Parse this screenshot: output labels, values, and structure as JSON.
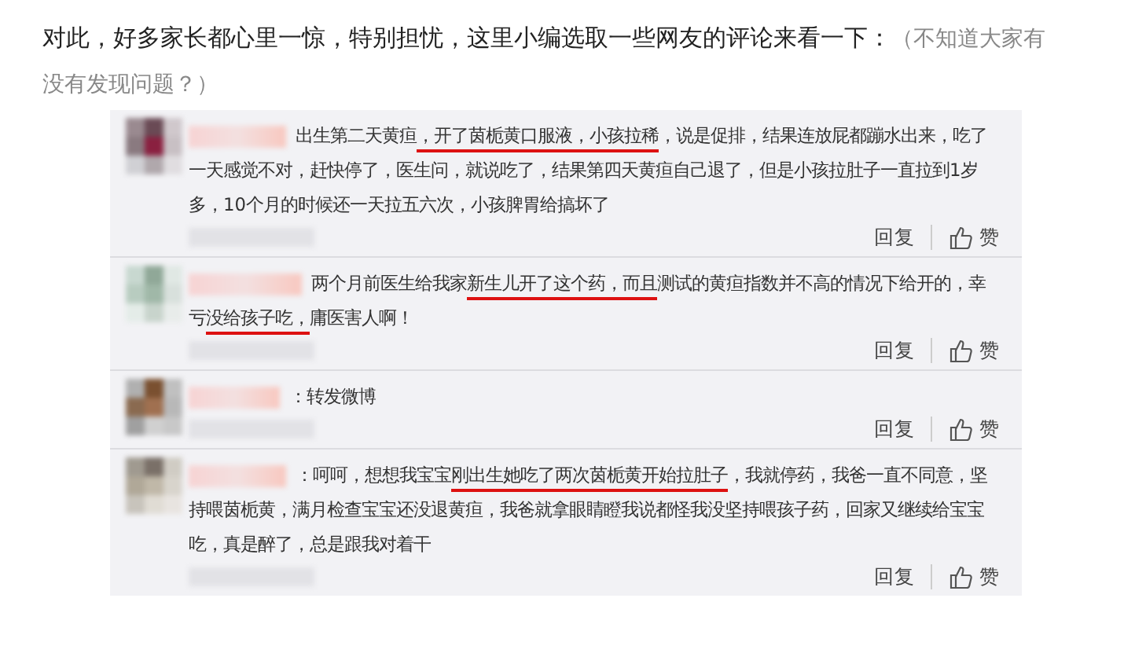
{
  "intro": {
    "text": "对此，好多家长都心里一惊，特别担忧，这里小编选取一些网友的评论来看一下：",
    "note": "（不知道大家有没有发现问题？）"
  },
  "comments": [
    {
      "segments": [
        {
          "text": "出生第二天黄疸",
          "underlined": false
        },
        {
          "text": "，开了茵栀黄口服液，小孩拉稀",
          "underlined": true
        },
        {
          "text": "，说是促排，结果连放屁都蹦水出来，吃了一天感觉不对，赶快停了，医生问，就说吃了，结果第四天黄疸自己退了，但是小孩拉肚子一直拉到1岁多，10个月的时候还一天拉五六次，小孩脾胃给搞坏了",
          "underlined": false
        }
      ],
      "reply": "回复",
      "like": "赞"
    },
    {
      "segments": [
        {
          "text": "两个月前医生给我家",
          "underlined": false
        },
        {
          "text": "新生儿开了这个药，而且",
          "underlined": true
        },
        {
          "text": "测试的黄疸指数并不高的情况下给开的，幸亏",
          "underlined": false
        },
        {
          "text": "没给孩子吃，",
          "underlined": true
        },
        {
          "text": "庸医害人啊！",
          "underlined": false
        }
      ],
      "reply": "回复",
      "like": "赞"
    },
    {
      "segments": [
        {
          "text": "：转发微博",
          "underlined": false
        }
      ],
      "reply": "回复",
      "like": "赞"
    },
    {
      "segments": [
        {
          "text": "：呵呵，想想我宝宝",
          "underlined": false
        },
        {
          "text": "刚出生她吃了两次茵栀黄开始拉肚子",
          "underlined": true
        },
        {
          "text": "，我就停药，我爸一直不同意，坚持喂茵栀黄，满月检查宝宝还没退黄疸，我爸就拿眼睛瞪我说都怪我没坚持喂孩子药，回家又继续给宝宝吃，真是醉了，总是跟我对着干",
          "underlined": false
        }
      ],
      "reply": "回复",
      "like": "赞"
    }
  ]
}
